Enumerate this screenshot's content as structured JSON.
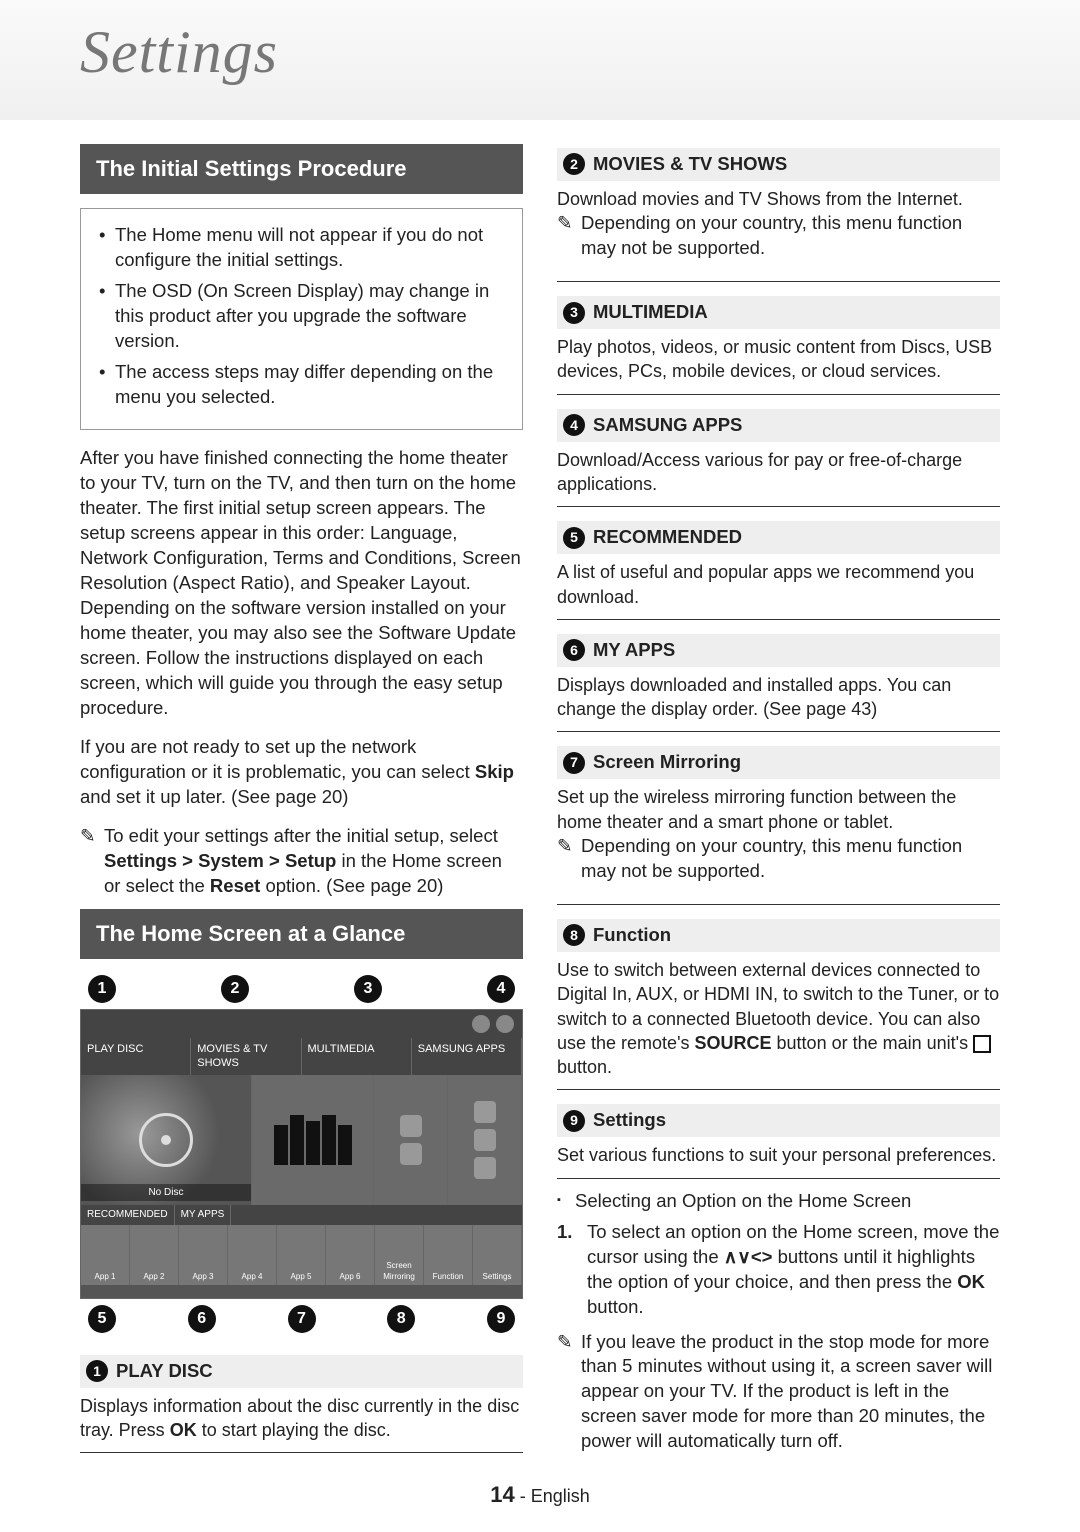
{
  "page_title": "Settings",
  "footer": {
    "page_num": "14",
    "lang": "English"
  },
  "left": {
    "sec1_header": "The Initial Settings Procedure",
    "box": {
      "b1": "The Home menu will not appear if you do not configure the initial settings.",
      "b2": "The OSD (On Screen Display) may change in this product after you upgrade the software version.",
      "b3": "The access steps may differ depending on the menu you selected."
    },
    "para1": "After you have finished connecting the home theater to your TV, turn on the TV, and then turn on the home theater. The first initial setup screen appears.  The setup screens appear in this order: Language, Network Configuration, Terms and Conditions, Screen Resolution (Aspect Ratio), and Speaker Layout. Depending on the software version installed on your home theater, you may also see the Software Update screen. Follow the instructions displayed on each screen, which will guide you through the easy setup procedure.",
    "para2a": "If you are not ready to set up the network configuration or it is problematic, you can select ",
    "para2b": "Skip",
    "para2c": " and set it up later. (See page 20)",
    "note1a": "To edit your settings after the initial setup, select ",
    "note1b": "Settings > System > Setup",
    "note1c": " in the Home screen or select the ",
    "note1d": "Reset",
    "note1e": " option. (See page 20)",
    "sec2_header": "The Home Screen at a Glance",
    "diagram": {
      "tabs": {
        "t1": "PLAY DISC",
        "t2": "MOVIES & TV SHOWS",
        "t3": "MULTIMEDIA",
        "t4": "SAMSUNG APPS"
      },
      "nodisc": "No Disc",
      "rec": "RECOMMENDED",
      "myapps": "MY APPS",
      "apps": {
        "a1": "App 1",
        "a2": "App 2",
        "a3": "App 3",
        "a4": "App 4",
        "a5": "App 5",
        "a6": "App 6",
        "a7": "Screen Mirroring",
        "a8": "Function",
        "a9": "Settings"
      }
    },
    "item1_head": "PLAY DISC",
    "item1_body_a": "Displays information about the disc currently in the disc tray. Press ",
    "item1_body_b": "OK",
    "item1_body_c": " to start playing the disc."
  },
  "right": {
    "i2_head": "MOVIES & TV SHOWS",
    "i2_body": "Download movies and TV Shows from the Internet.",
    "i2_note": "Depending on your country, this menu function may not be supported.",
    "i3_head": "MULTIMEDIA",
    "i3_body": "Play photos, videos, or music content from Discs, USB devices, PCs, mobile devices, or cloud services.",
    "i4_head": "SAMSUNG APPS",
    "i4_body": "Download/Access various for pay or free-of-charge applications.",
    "i5_head": "RECOMMENDED",
    "i5_body": "A list of useful and popular apps we recommend you download.",
    "i6_head": "MY APPS",
    "i6_body": "Displays downloaded and installed apps. You can change the display order. (See page 43)",
    "i7_head": "Screen Mirroring",
    "i7_body": "Set up the wireless mirroring function between the home theater and a smart phone or tablet.",
    "i7_note": "Depending on your country, this menu function may not be supported.",
    "i8_head": "Function",
    "i8_body_a": "Use to switch between external devices connected to Digital In, AUX, or HDMI IN, to switch to the Tuner, or to switch to a connected Bluetooth device. You can also use the remote's ",
    "i8_body_b": "SOURCE",
    "i8_body_c": " button or the main unit's ",
    "i8_body_d": " button.",
    "i9_head": "Settings",
    "i9_body": "Set various functions to suit your personal preferences.",
    "sel_bullet": "Selecting an Option on the Home Screen",
    "step1_a": "To select an option on the Home screen, move the cursor using the ",
    "step1_b": " buttons until it highlights the option of your choice, and then press the ",
    "step1_c": "OK",
    "step1_d": " button.",
    "final_note": "If you leave the product in the stop mode for more than 5 minutes without using it, a screen saver will appear on your TV. If the product is left in the screen saver mode for more than 20 minutes, the power will automatically turn off."
  }
}
